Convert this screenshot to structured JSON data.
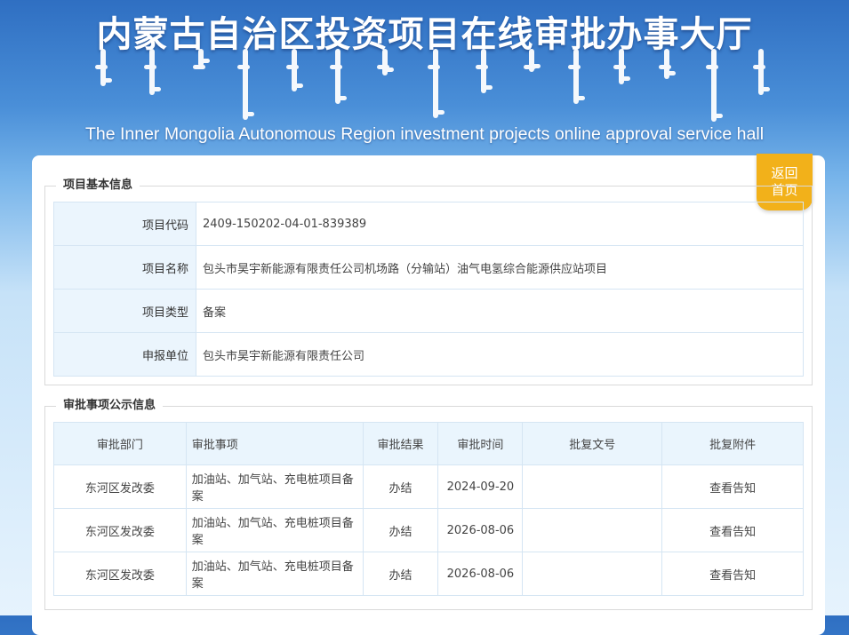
{
  "banner": {
    "title_cn": "内蒙古自治区投资项目在线审批办事大厅",
    "title_en": "The Inner Mongolia Autonomous Region investment projects online approval service hall"
  },
  "back_button": {
    "line1": "返回",
    "line2": "首页",
    "color": "#f2b11a"
  },
  "project_info": {
    "legend": "项目基本信息",
    "rows": [
      {
        "label": "项目代码",
        "value": "2409-150202-04-01-839389"
      },
      {
        "label": "项目名称",
        "value": "包头市昊宇新能源有限责任公司机场路（分输站）油气电氢综合能源供应站项目"
      },
      {
        "label": "项目类型",
        "value": "备案"
      },
      {
        "label": "申报单位",
        "value": "包头市昊宇新能源有限责任公司"
      }
    ]
  },
  "approvals": {
    "legend": "审批事项公示信息",
    "headers": [
      "审批部门",
      "审批事项",
      "审批结果",
      "审批时间",
      "批复文号",
      "批复附件"
    ],
    "rows": [
      {
        "dept": "东河区发改委",
        "item": "加油站、加气站、充电桩项目备案",
        "result": "办结",
        "date": "2024-09-20",
        "doc_no": "",
        "attachment": "查看告知"
      },
      {
        "dept": "东河区发改委",
        "item": "加油站、加气站、充电桩项目备案",
        "result": "办结",
        "date": "2026-08-06",
        "doc_no": "",
        "attachment": "查看告知"
      },
      {
        "dept": "东河区发改委",
        "item": "加油站、加气站、充电桩项目备案",
        "result": "办结",
        "date": "2026-08-06",
        "doc_no": "",
        "attachment": "查看告知"
      }
    ]
  },
  "colors": {
    "accent": "#f2b11a",
    "header_blue": "#2f6fc2",
    "table_label_bg": "#ebf5fd"
  }
}
